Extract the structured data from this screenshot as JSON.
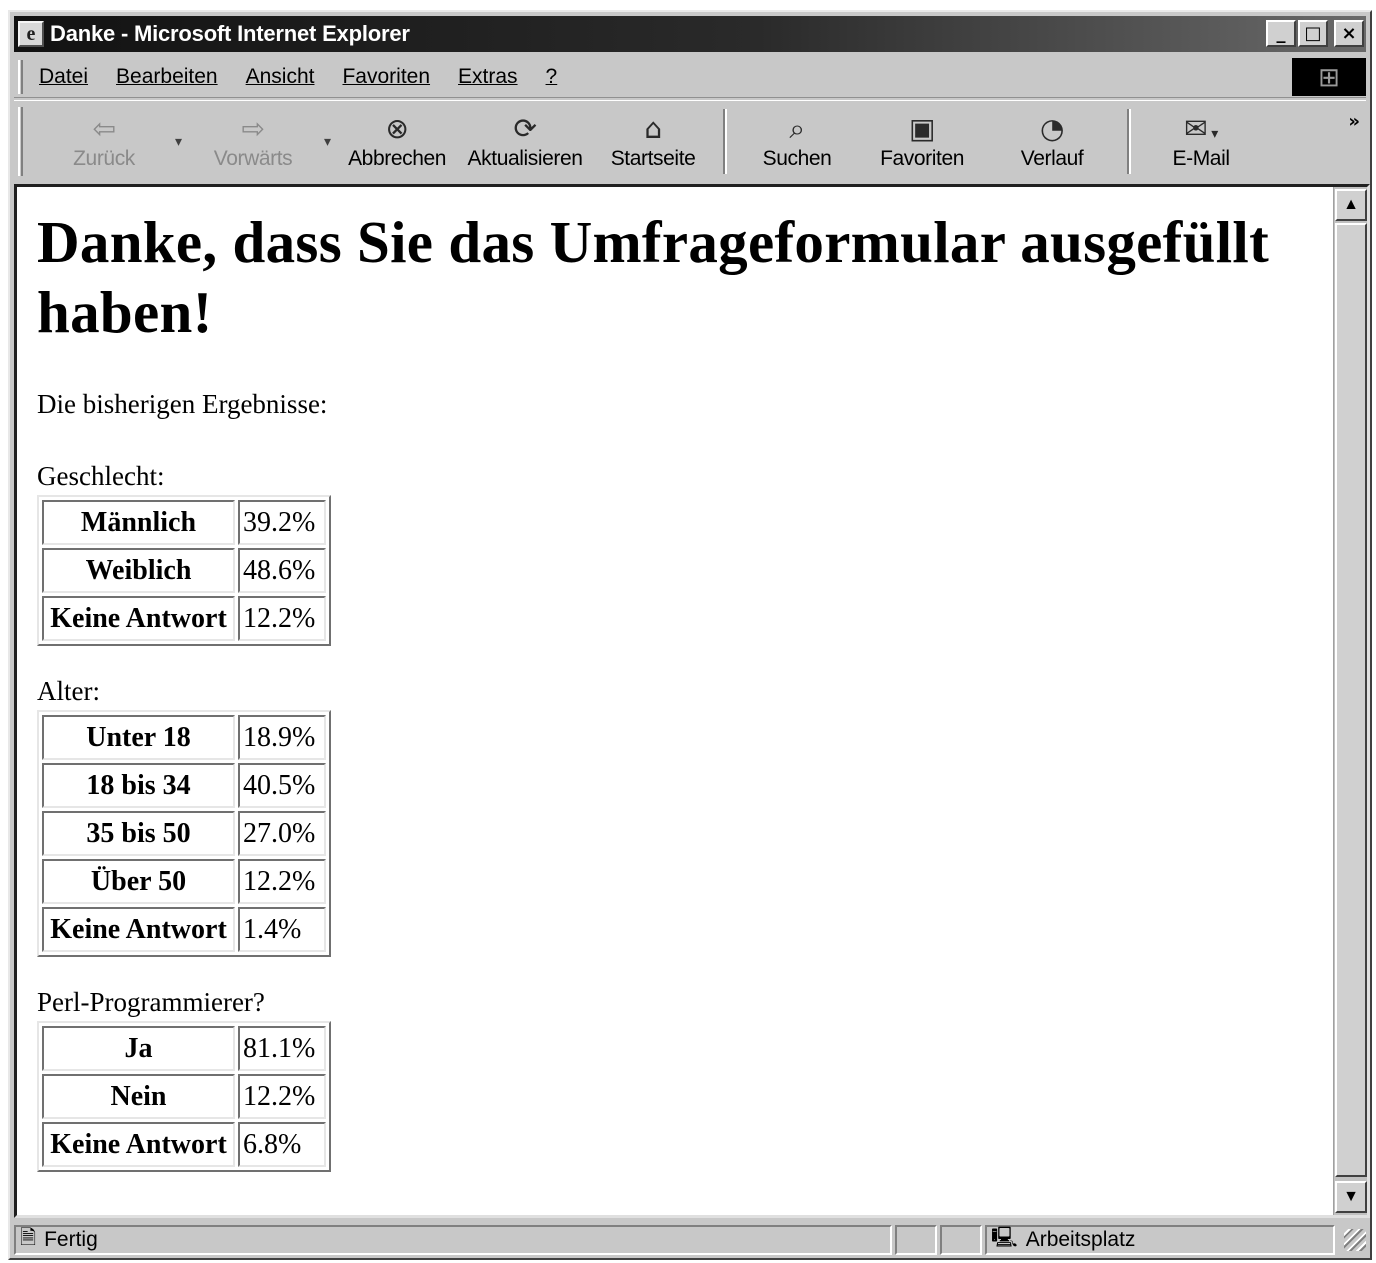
{
  "window": {
    "title": "Danke - Microsoft Internet Explorer",
    "controls": {
      "minimize": "_",
      "maximize": "□",
      "close": "×"
    }
  },
  "menu": [
    {
      "label": "Datei"
    },
    {
      "label": "Bearbeiten"
    },
    {
      "label": "Ansicht"
    },
    {
      "label": "Favoriten"
    },
    {
      "label": "Extras"
    },
    {
      "label": "?"
    }
  ],
  "toolbar": {
    "back": {
      "label": "Zurück",
      "icon": "arrow-left-icon",
      "glyph": "⇦"
    },
    "forward": {
      "label": "Vorwärts",
      "icon": "arrow-right-icon",
      "glyph": "⇨"
    },
    "stop": {
      "label": "Abbrechen",
      "icon": "stop-icon",
      "glyph": "⊗"
    },
    "refresh": {
      "label": "Aktualisieren",
      "icon": "refresh-icon",
      "glyph": "⟳"
    },
    "home": {
      "label": "Startseite",
      "icon": "home-icon",
      "glyph": "⌂"
    },
    "search": {
      "label": "Suchen",
      "icon": "search-icon",
      "glyph": "⌕"
    },
    "favorites": {
      "label": "Favoriten",
      "icon": "favorites-icon",
      "glyph": "▣"
    },
    "history": {
      "label": "Verlauf",
      "icon": "history-icon",
      "glyph": "◔"
    },
    "mail": {
      "label": "E-Mail",
      "icon": "mail-icon",
      "glyph": "✉"
    },
    "more": "»"
  },
  "page": {
    "heading": "Danke, dass Sie das Umfrageformular ausgefüllt haben!",
    "intro": "Die bisherigen Ergebnisse:",
    "sections": [
      {
        "label": "Geschlecht:",
        "rows": [
          {
            "label": "Männlich",
            "value": "39.2%"
          },
          {
            "label": "Weiblich",
            "value": "48.6%"
          },
          {
            "label": "Keine Antwort",
            "value": "12.2%"
          }
        ]
      },
      {
        "label": "Alter:",
        "rows": [
          {
            "label": "Unter 18",
            "value": "18.9%"
          },
          {
            "label": "18 bis 34",
            "value": "40.5%"
          },
          {
            "label": "35 bis 50",
            "value": "27.0%"
          },
          {
            "label": "Über 50",
            "value": "12.2%"
          },
          {
            "label": "Keine Antwort",
            "value": "1.4%"
          }
        ]
      },
      {
        "label": "Perl-Programmierer?",
        "rows": [
          {
            "label": "Ja",
            "value": "81.1%"
          },
          {
            "label": "Nein",
            "value": "12.2%"
          },
          {
            "label": "Keine Antwort",
            "value": "6.8%"
          }
        ]
      }
    ]
  },
  "status": {
    "text": "Fertig",
    "zone": "Arbeitsplatz"
  }
}
